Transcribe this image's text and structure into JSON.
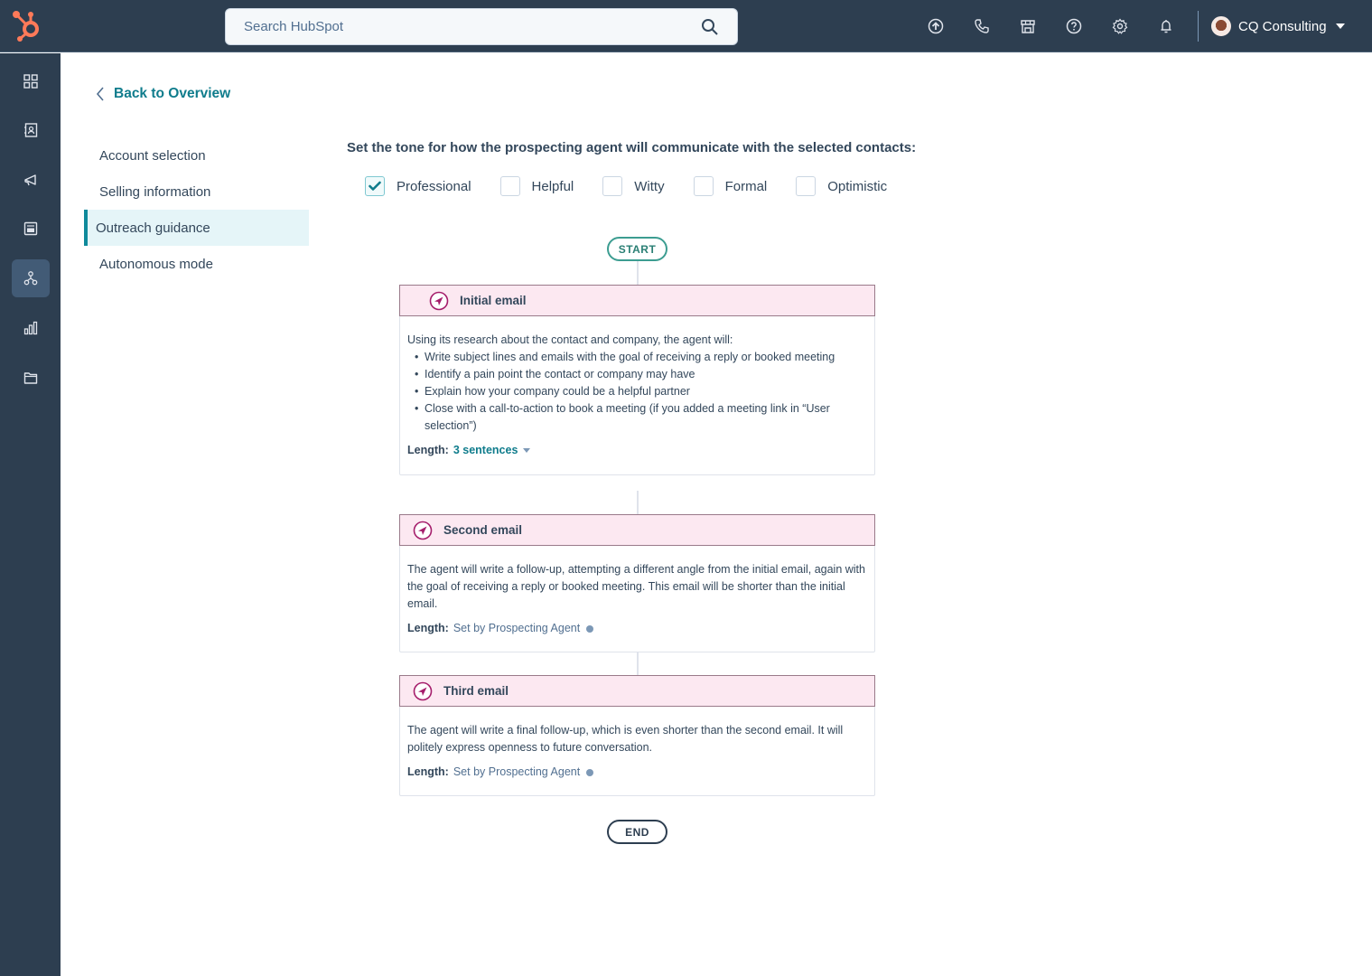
{
  "topbar": {
    "search": {
      "placeholder": "Search HubSpot",
      "value": ""
    },
    "icons": [
      "upgrade-icon",
      "calling-icon",
      "marketplace-icon",
      "help-icon",
      "settings-icon",
      "notifications-icon"
    ],
    "account": {
      "name": "CQ Consulting"
    }
  },
  "leftnav": {
    "items": [
      {
        "icon": "bookmarks-icon",
        "active": false
      },
      {
        "icon": "contacts-icon",
        "active": false
      },
      {
        "icon": "marketing-icon",
        "active": false
      },
      {
        "icon": "content-icon",
        "active": false
      },
      {
        "icon": "automation-icon",
        "active": true
      },
      {
        "icon": "reporting-icon",
        "active": false
      },
      {
        "icon": "library-icon",
        "active": false
      }
    ]
  },
  "back_link": "Back to Overview",
  "steps": [
    {
      "label": "Account selection",
      "active": false
    },
    {
      "label": "Selling information",
      "active": false
    },
    {
      "label": "Outreach guidance",
      "active": true
    },
    {
      "label": "Autonomous mode",
      "active": false
    }
  ],
  "tone": {
    "heading": "Set the tone for how the prospecting agent will communicate with the selected contacts:",
    "options": [
      {
        "label": "Professional",
        "checked": true
      },
      {
        "label": "Helpful",
        "checked": false
      },
      {
        "label": "Witty",
        "checked": false
      },
      {
        "label": "Formal",
        "checked": false
      },
      {
        "label": "Optimistic",
        "checked": false
      }
    ]
  },
  "flow": {
    "start_label": "START",
    "end_label": "END",
    "emails": [
      {
        "title": "Initial email",
        "intro": "Using its research about the contact and company, the agent will:",
        "bullets": [
          "Write subject lines and emails with the goal of receiving a reply or booked meeting",
          "Identify a pain point the contact or company may have",
          "Explain how your company could be a helpful partner",
          "Close with a call-to-action to book a meeting (if you added a meeting link in “User selection”)"
        ],
        "length_label": "Length:",
        "length_value": "3 sentences"
      },
      {
        "title": "Second email",
        "description": "The agent will write a follow-up, attempting a different angle from the initial email, again with the goal of receiving a reply or booked meeting. This email will be shorter than the initial email.",
        "length_label": "Length:",
        "length_value": "Set by Prospecting Agent"
      },
      {
        "title": "Third email",
        "description": "The agent will write a final follow-up, which is even shorter than the second email. It will politely express openness to future conversation.",
        "length_label": "Length:",
        "length_value": "Set by Prospecting Agent"
      }
    ]
  },
  "colors": {
    "nav_bg": "#2d3e50",
    "accent_teal": "#0f7c8c",
    "brand_orange": "#ff7a59",
    "email_header_bg": "#fce8f1",
    "email_icon": "#a51d6b"
  }
}
